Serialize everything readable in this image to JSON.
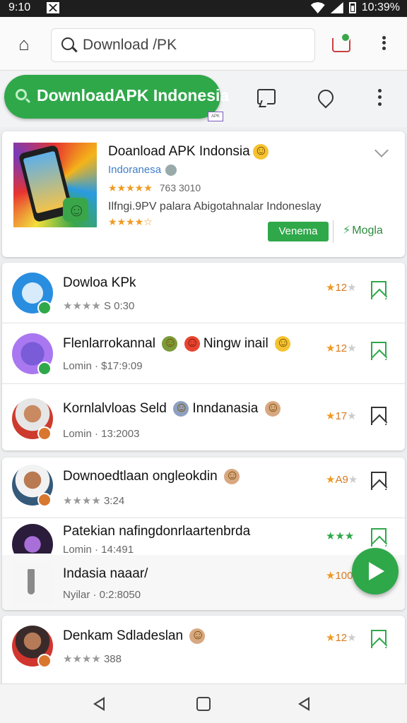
{
  "status_bar": {
    "time": "9:10",
    "clock_right": "10:39%"
  },
  "browser": {
    "search_value": "Download /PK"
  },
  "header": {
    "pill_text": "DownloadAPK Indonesia",
    "mini_badge": "APK"
  },
  "featured": {
    "title": "Doanload APK Indonsia",
    "developer": "Indoranesa",
    "stars": "★★★★★",
    "rating_count": "763 3010",
    "description": "Ilfngi.9PV palara Abigotahnalar Indoneslay",
    "stars2": "★★★★☆",
    "install_label": "Venema",
    "secondary_label": "Mogla"
  },
  "group1": [
    {
      "title": "Dowloa KPk",
      "stars": "★★★★",
      "sub": "S 0:30",
      "rating": "12",
      "bookmark_color": "#2fa84a"
    },
    {
      "title": "Flenlarrokannal",
      "title_suffix": "Ningw inail",
      "stars": "",
      "sub": "Lomin · $17:9:09",
      "rating": "12",
      "bookmark_color": "#2fa84a"
    },
    {
      "title": "Kornlalvloas Seld",
      "title_suffix": "Inndanasia",
      "stars": "",
      "sub": "Lomin · 13:2003",
      "rating": "17",
      "bookmark_color": "#333333"
    }
  ],
  "group2": [
    {
      "title": "Downoedtlaan ongleokdin",
      "stars": "★★★★",
      "sub": "3:24",
      "rating": "A9",
      "bookmark_color": "#333333"
    },
    {
      "title": "Patekian nafingdonrlaartenbrda",
      "stars": "",
      "sub": "Lomin · 14:491",
      "rating": "★★★",
      "bookmark_color": "#2fa84a"
    },
    {
      "title": "Indasia naaar/",
      "stars": "",
      "sub": "Nyilar · 0:2:8050",
      "rating": "100",
      "bookmark_color": "#333333"
    }
  ],
  "group3": [
    {
      "title": "Denkam Sdladeslan",
      "stars": "★★★★",
      "sub": "388",
      "rating": "12",
      "bookmark_color": "#2fa84a"
    }
  ],
  "icons": {
    "home": "home-icon",
    "search": "search-icon",
    "tray": "download-tray-icon",
    "more": "more-vert-icon",
    "chat": "chat-icon",
    "tag": "tag-icon",
    "fab": "play-icon"
  },
  "colors": {
    "accent": "#2fa84a",
    "star": "#f19a21",
    "link": "#3f7ec8"
  }
}
